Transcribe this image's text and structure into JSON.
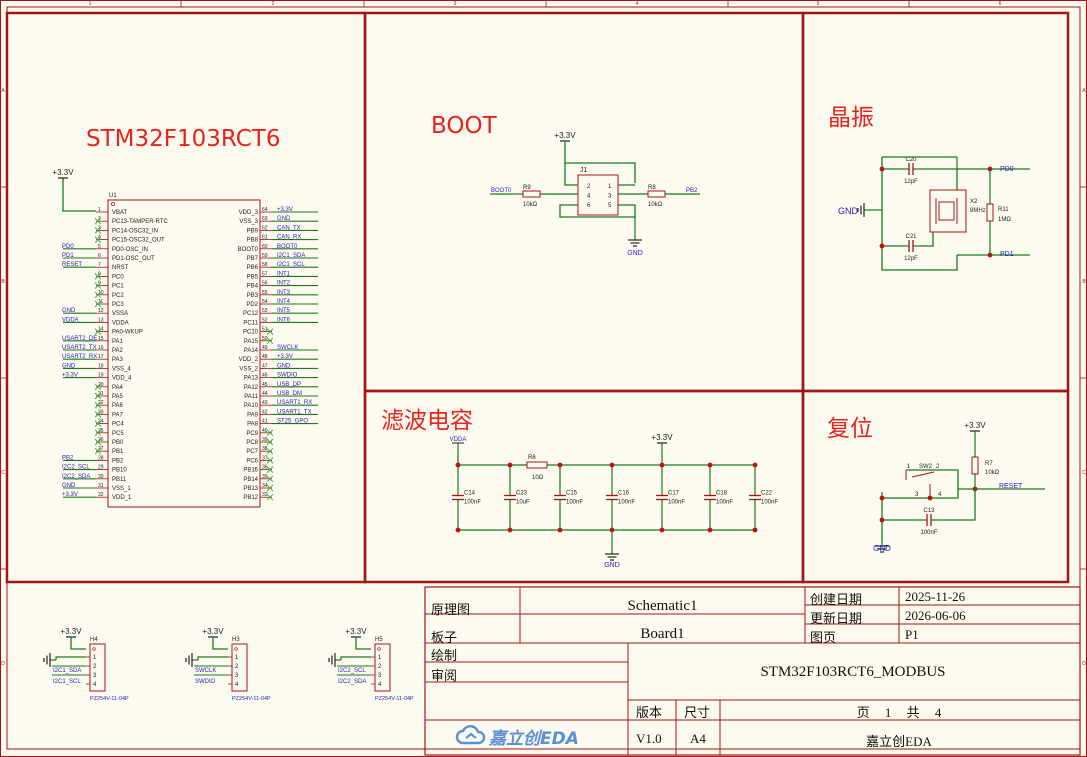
{
  "sections": {
    "mcu": "STM32F103RCT6",
    "boot": "BOOT",
    "crystal": "晶振",
    "filter": "滤波电容",
    "reset": "复位"
  },
  "title_block": {
    "schematic_label": "原理图",
    "schematic_value": "Schematic1",
    "board_label": "板子",
    "board_value": "Board1",
    "drawn_label": "绘制",
    "review_label": "审阅",
    "created_label": "创建日期",
    "created_value": "2025-11-26",
    "updated_label": "更新日期",
    "updated_value": "2026-06-06",
    "page_label": "图页",
    "page_value": "P1",
    "project": "STM32F103RCT6_MODBUS",
    "version_label": "版本",
    "version_value": "V1.0",
    "size_label": "尺寸",
    "size_value": "A4",
    "pages_text": "页 1 共 4",
    "company": "嘉立创EDA",
    "logo": "嘉立创EDA"
  },
  "border": {
    "cols": [
      "1",
      "2",
      "3",
      "4",
      "5",
      "6"
    ],
    "rows": [
      "A",
      "B",
      "C",
      "D"
    ]
  },
  "mcu": {
    "ref": "U1",
    "power_net": "+3.3V",
    "left_pins": [
      {
        "n": "1",
        "name": "VBAT",
        "net": ""
      },
      {
        "n": "2",
        "name": "PC13-TAMPER-RTC",
        "net": ""
      },
      {
        "n": "3",
        "name": "PC14-OSC32_IN",
        "net": ""
      },
      {
        "n": "4",
        "name": "PC15-OSC32_OUT",
        "net": ""
      },
      {
        "n": "5",
        "name": "PD0-OSC_IN",
        "net": "PD0"
      },
      {
        "n": "6",
        "name": "PD1-OSC_OUT",
        "net": "PD1"
      },
      {
        "n": "7",
        "name": "NRST",
        "net": "RESET"
      },
      {
        "n": "8",
        "name": "PC0",
        "net": ""
      },
      {
        "n": "9",
        "name": "PC1",
        "net": ""
      },
      {
        "n": "10",
        "name": "PC2",
        "net": ""
      },
      {
        "n": "11",
        "name": "PC3",
        "net": ""
      },
      {
        "n": "12",
        "name": "VSSA",
        "net": "GND"
      },
      {
        "n": "13",
        "name": "VDDA",
        "net": "VDDA"
      },
      {
        "n": "14",
        "name": "PA0-WKUP",
        "net": ""
      },
      {
        "n": "15",
        "name": "PA1",
        "net": "USART2_DE"
      },
      {
        "n": "16",
        "name": "PA2",
        "net": "USART2_TX"
      },
      {
        "n": "17",
        "name": "PA3",
        "net": "USART2_RX"
      },
      {
        "n": "18",
        "name": "VSS_4",
        "net": "GND"
      },
      {
        "n": "19",
        "name": "VDD_4",
        "net": "+3.3V"
      },
      {
        "n": "20",
        "name": "PA4",
        "net": ""
      },
      {
        "n": "21",
        "name": "PA5",
        "net": ""
      },
      {
        "n": "22",
        "name": "PA6",
        "net": ""
      },
      {
        "n": "23",
        "name": "PA7",
        "net": ""
      },
      {
        "n": "24",
        "name": "PC4",
        "net": ""
      },
      {
        "n": "25",
        "name": "PC5",
        "net": ""
      },
      {
        "n": "26",
        "name": "PB0",
        "net": ""
      },
      {
        "n": "27",
        "name": "PB1",
        "net": ""
      },
      {
        "n": "28",
        "name": "PB2",
        "net": "PB2"
      },
      {
        "n": "29",
        "name": "PB10",
        "net": "I2C2_SCL"
      },
      {
        "n": "30",
        "name": "PB11",
        "net": "I2C2_SDA"
      },
      {
        "n": "31",
        "name": "VSS_1",
        "net": "GND"
      },
      {
        "n": "32",
        "name": "VDD_1",
        "net": "+3.3V"
      }
    ],
    "right_pins": [
      {
        "n": "64",
        "name": "VDD_3",
        "net": "+3.3V"
      },
      {
        "n": "63",
        "name": "VSS_3",
        "net": "GND"
      },
      {
        "n": "62",
        "name": "PB9",
        "net": "CAN_TX"
      },
      {
        "n": "61",
        "name": "PB8",
        "net": "CAN_RX"
      },
      {
        "n": "60",
        "name": "BOOT0",
        "net": "BOOT0"
      },
      {
        "n": "59",
        "name": "PB7",
        "net": "I2C1_SDA"
      },
      {
        "n": "58",
        "name": "PB6",
        "net": "I2C1_SCL"
      },
      {
        "n": "57",
        "name": "PB5",
        "net": "INT1"
      },
      {
        "n": "56",
        "name": "PB4",
        "net": "INT2"
      },
      {
        "n": "55",
        "name": "PB3",
        "net": "INT3"
      },
      {
        "n": "54",
        "name": "PD2",
        "net": "INT4"
      },
      {
        "n": "53",
        "name": "PC12",
        "net": "INT5"
      },
      {
        "n": "52",
        "name": "PC11",
        "net": "INT6"
      },
      {
        "n": "51",
        "name": "PC10",
        "net": ""
      },
      {
        "n": "50",
        "name": "PA15",
        "net": ""
      },
      {
        "n": "49",
        "name": "PA14",
        "net": "SWCLK"
      },
      {
        "n": "48",
        "name": "VDD_2",
        "net": "+3.3V"
      },
      {
        "n": "47",
        "name": "VSS_2",
        "net": "GND"
      },
      {
        "n": "46",
        "name": "PA13",
        "net": "SWDIO"
      },
      {
        "n": "45",
        "name": "PA12",
        "net": "USB_DP"
      },
      {
        "n": "44",
        "name": "PA11",
        "net": "USB_DM"
      },
      {
        "n": "43",
        "name": "PA10",
        "net": "USART1_RX"
      },
      {
        "n": "42",
        "name": "PA9",
        "net": "USART1_TX"
      },
      {
        "n": "41",
        "name": "PA8",
        "net": "ST25_GPO"
      },
      {
        "n": "40",
        "name": "PC9",
        "net": ""
      },
      {
        "n": "39",
        "name": "PC8",
        "net": ""
      },
      {
        "n": "38",
        "name": "PC7",
        "net": ""
      },
      {
        "n": "37",
        "name": "PC6",
        "net": ""
      },
      {
        "n": "36",
        "name": "PB15",
        "net": ""
      },
      {
        "n": "35",
        "name": "PB14",
        "net": ""
      },
      {
        "n": "34",
        "name": "PB13",
        "net": ""
      },
      {
        "n": "33",
        "name": "PB12",
        "net": ""
      }
    ]
  },
  "boot": {
    "power": "+3.3V",
    "header": "J1",
    "pins_left": [
      "2",
      "4",
      "6"
    ],
    "pins_right": [
      "1",
      "3",
      "5"
    ],
    "r_left": {
      "ref": "R9",
      "val": "10kΩ"
    },
    "r_right": {
      "ref": "R8",
      "val": "10kΩ"
    },
    "net_left": "BOOT0",
    "net_right": "PB2",
    "gnd": "GND"
  },
  "crystal": {
    "c_top": {
      "ref": "C20",
      "val": "12pF"
    },
    "c_bot": {
      "ref": "C21",
      "val": "12pF"
    },
    "xtal": {
      "ref": "X2",
      "val": "8MHz"
    },
    "r": {
      "ref": "R11",
      "val": "1MΩ"
    },
    "net_top": "PD0",
    "net_bot": "PD1",
    "gnd": "GND"
  },
  "filter": {
    "vdda": "VDDA",
    "vcc": "+3.3V",
    "r": {
      "ref": "R6",
      "val": "10Ω"
    },
    "caps": [
      {
        "ref": "C14",
        "val": "100nF"
      },
      {
        "ref": "C23",
        "val": "10uF"
      },
      {
        "ref": "C15",
        "val": "100nF"
      },
      {
        "ref": "C16",
        "val": "100nF"
      },
      {
        "ref": "C17",
        "val": "100nF"
      },
      {
        "ref": "C18",
        "val": "100nF"
      },
      {
        "ref": "C22",
        "val": "100nF"
      }
    ],
    "gnd": "GND"
  },
  "reset": {
    "power": "+3.3V",
    "r": {
      "ref": "R7",
      "val": "10kΩ"
    },
    "sw": {
      "ref": "SW2",
      "pins": [
        "1",
        "2",
        "3",
        "4"
      ]
    },
    "c": {
      "ref": "C13",
      "val": "100nF"
    },
    "net": "RESET",
    "gnd": "GND"
  },
  "headers": [
    {
      "ref": "H4",
      "power": "+3.3V",
      "nets": [
        "I2C1_SDA",
        "I2C1_SCL"
      ],
      "part": "PZ254V-11-04P",
      "pins": [
        "1",
        "2",
        "3",
        "4"
      ]
    },
    {
      "ref": "H3",
      "power": "+3.3V",
      "nets": [
        "SWCLK",
        "SWDIO"
      ],
      "part": "PZ254V-11-04P",
      "pins": [
        "1",
        "2",
        "3",
        "4"
      ]
    },
    {
      "ref": "H5",
      "power": "+3.3V",
      "nets": [
        "I2C2_SCL",
        "I2C2_SDA"
      ],
      "part": "PZ254V-11-04P",
      "pins": [
        "1",
        "2",
        "3",
        "4"
      ]
    }
  ],
  "colors": {
    "frame": "#a31515",
    "wire": "#1b7a1b",
    "netlabel": "#1f1fbf",
    "component": "#a31515",
    "text": "#222222",
    "title": "#e8231c",
    "junction": "#c01010",
    "nc": "#3cb43c",
    "bg": "#fdfaf0"
  }
}
